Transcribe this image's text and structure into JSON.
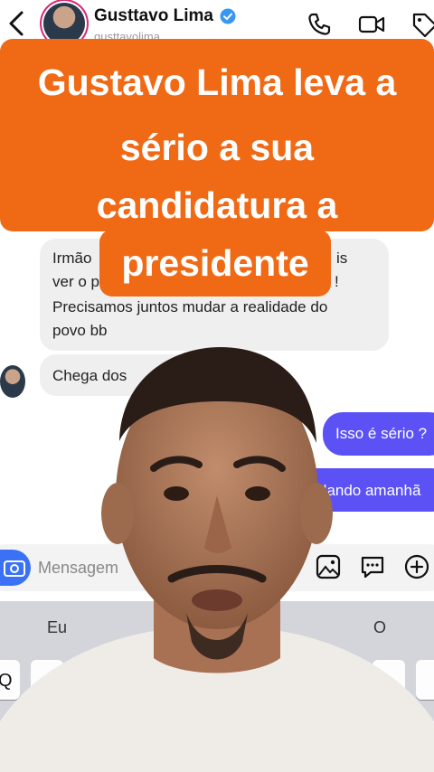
{
  "header": {
    "contact_name": "Gusttavo Lima",
    "username": "gusttavolima",
    "icons": [
      "back-chevron-icon",
      "verified-badge-icon",
      "phone-icon",
      "video-call-icon",
      "tag-icon"
    ]
  },
  "banner": {
    "line1": "Gustavo Lima leva a",
    "line2": "sério a sua",
    "line3": "candidatura a",
    "line4": "presidente",
    "color": "#f06a16"
  },
  "chat": {
    "incoming": {
      "line1": "Irmão",
      "line1_trail": "is",
      "line2": "ver o p",
      "line2_trail": "!",
      "line3": "Precisamos juntos mudar a realidade do",
      "line4": "povo bb"
    },
    "incoming2": "Chega dos",
    "outgoing1": "Isso é sério ?",
    "outgoing2": "rlando amanhã",
    "outgoing_color": "#5b51f5"
  },
  "composer": {
    "placeholder": "Mensagem",
    "icons": [
      "camera-icon",
      "image-icon",
      "sticker-chat-icon",
      "plus-circle-icon"
    ]
  },
  "keyboard": {
    "suggestion_left": "Eu",
    "suggestion_right": "O",
    "first_key": "Q"
  }
}
